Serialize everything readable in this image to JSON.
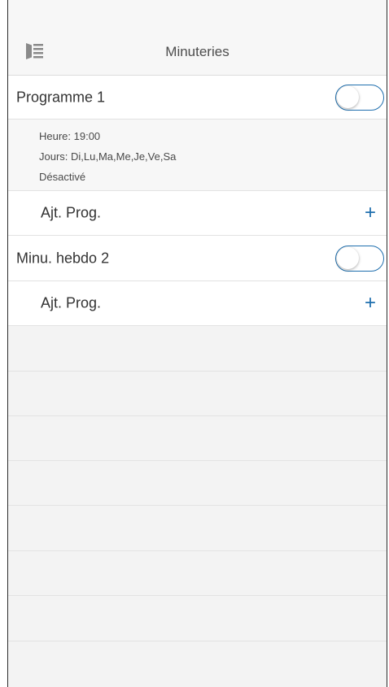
{
  "header": {
    "title": "Minuteries",
    "menu_icon": "sidebar-menu-icon"
  },
  "timers": [
    {
      "name": "Programme 1",
      "enabled": false,
      "details": {
        "time": "Heure: 19:00",
        "days": "Jours: Di,Lu,Ma,Me,Je,Ve,Sa",
        "status": "Désactivé"
      },
      "add_label": "Ajt. Prog.",
      "add_icon": "+"
    },
    {
      "name": "Minu. hebdo 2",
      "enabled": false,
      "add_label": "Ajt. Prog.",
      "add_icon": "+"
    }
  ],
  "colors": {
    "accent": "#1f6fae",
    "background": "#f3f3f3",
    "row": "#ffffff",
    "divider": "#e2e2e2"
  }
}
